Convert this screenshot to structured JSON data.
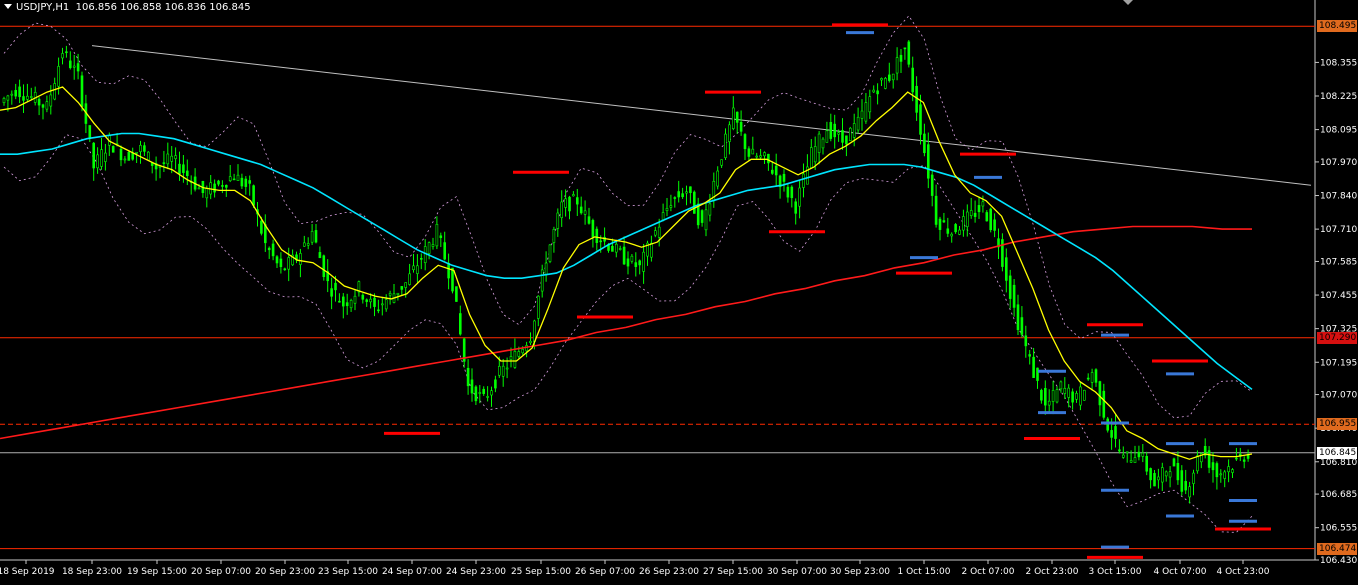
{
  "header": {
    "symbol": "USDJPY,H1",
    "ohlc": "106.856 106.858 106.836 106.845"
  },
  "colors": {
    "background": "#000000",
    "candle": "#00ff00",
    "ma_fast": "#ffff00",
    "ma_mid": "#00e5ff",
    "ma_slow": "#ff1a1a",
    "bands": "#d8a0e0",
    "trendline": "#c0c0c0",
    "resistance": "#ff0000",
    "support": "#3a78d8",
    "hline": "#ff2a00"
  },
  "chart_data": {
    "type": "candlestick",
    "title": "USDJPY,H1",
    "y_axis_ticks": [
      "108.355",
      "108.225",
      "108.095",
      "107.970",
      "107.840",
      "107.710",
      "107.585",
      "107.455",
      "107.325",
      "107.195",
      "107.070",
      "106.940",
      "106.810",
      "106.685",
      "106.555",
      "106.430"
    ],
    "ylim": [
      106.43,
      108.55
    ],
    "x_axis_ticks": [
      "18 Sep 2019",
      "18 Sep 23:00",
      "19 Sep 15:00",
      "20 Sep 07:00",
      "20 Sep 23:00",
      "23 Sep 15:00",
      "24 Sep 07:00",
      "24 Sep 23:00",
      "25 Sep 15:00",
      "26 Sep 07:00",
      "26 Sep 23:00",
      "27 Sep 15:00",
      "30 Sep 07:00",
      "30 Sep 23:00",
      "1 Oct 15:00",
      "2 Oct 07:00",
      "2 Oct 23:00",
      "3 Oct 15:00",
      "4 Oct 07:00",
      "4 Oct 23:00"
    ],
    "price_labels": [
      {
        "text": "108.495",
        "value": 108.495,
        "style": "orange"
      },
      {
        "text": "107.290",
        "value": 107.29,
        "style": "red"
      },
      {
        "text": "106.955",
        "value": 106.955,
        "style": "orange"
      },
      {
        "text": "106.845",
        "value": 106.845,
        "style": "current"
      },
      {
        "text": "106.474",
        "value": 106.474,
        "style": "orange"
      }
    ],
    "horizontal_lines": [
      108.495,
      107.29,
      106.955,
      106.474
    ],
    "bid_line": 106.845,
    "trendline": {
      "start": [
        "18 Sep 23:00",
        108.42
      ],
      "end": [
        "4 Oct 23:00",
        107.91
      ]
    },
    "resistance_levels": [
      {
        "time": "30 Sep 23:00",
        "value": 108.5
      },
      {
        "time": "27 Sep 15:00",
        "value": 108.24
      },
      {
        "time": "25 Sep 15:00",
        "value": 107.93
      },
      {
        "time": "2 Oct 07:00",
        "value": 108.0
      },
      {
        "time": "30 Sep 07:00",
        "value": 107.7
      },
      {
        "time": "26 Sep 07:00",
        "value": 107.37
      },
      {
        "time": "1 Oct 15:00",
        "value": 107.54
      },
      {
        "time": "3 Oct 15:00",
        "value": 107.34
      },
      {
        "time": "4 Oct 07:00",
        "value": 107.2
      },
      {
        "time": "24 Sep 07:00",
        "value": 106.92
      },
      {
        "time": "2 Oct 23:00",
        "value": 106.9
      },
      {
        "time": "4 Oct 23:00",
        "value": 106.55
      },
      {
        "time": "3 Oct 15:00",
        "value": 106.44
      }
    ],
    "support_levels": [
      {
        "time": "30 Sep 23:00",
        "value": 108.47
      },
      {
        "time": "2 Oct 07:00",
        "value": 107.91
      },
      {
        "time": "1 Oct 15:00",
        "value": 107.6
      },
      {
        "time": "3 Oct 15:00",
        "value": 107.3
      },
      {
        "time": "2 Oct 23:00",
        "value": 107.16
      },
      {
        "time": "2 Oct 23:00",
        "value": 107.0
      },
      {
        "time": "3 Oct 15:00",
        "value": 106.96
      },
      {
        "time": "4 Oct 07:00",
        "value": 107.15
      },
      {
        "time": "4 Oct 07:00",
        "value": 106.88
      },
      {
        "time": "3 Oct 15:00",
        "value": 106.7
      },
      {
        "time": "4 Oct 23:00",
        "value": 106.88
      },
      {
        "time": "4 Oct 23:00",
        "value": 106.66
      },
      {
        "time": "4 Oct 07:00",
        "value": 106.6
      },
      {
        "time": "4 Oct 23:00",
        "value": 106.58
      },
      {
        "time": "3 Oct 15:00",
        "value": 106.48
      }
    ],
    "series": [
      {
        "name": "close",
        "values": [
          108.2,
          108.25,
          108.22,
          108.18,
          108.4,
          108.3,
          107.95,
          108.05,
          107.99,
          108.02,
          107.95,
          107.98,
          107.92,
          107.85,
          107.88,
          107.92,
          107.86,
          107.65,
          107.55,
          107.6,
          107.7,
          107.5,
          107.42,
          107.48,
          107.4,
          107.45,
          107.5,
          107.6,
          107.7,
          107.5,
          107.1,
          107.05,
          107.15,
          107.22,
          107.3,
          107.6,
          107.8,
          107.82,
          107.7,
          107.65,
          107.6,
          107.56,
          107.7,
          107.82,
          107.86,
          107.72,
          107.95,
          108.15,
          108.0,
          107.98,
          107.9,
          107.8,
          108.0,
          108.1,
          108.05,
          108.12,
          108.25,
          108.3,
          108.41,
          108.1,
          107.75,
          107.7,
          107.75,
          107.8,
          107.66,
          107.4,
          107.2,
          107.02,
          107.1,
          107.05,
          107.16,
          106.95,
          106.82,
          106.85,
          106.72,
          106.8,
          106.7,
          106.86,
          106.76,
          106.8,
          106.845
        ]
      },
      {
        "name": "MA fast",
        "values": [
          108.17,
          108.18,
          108.21,
          108.24,
          108.26,
          108.2,
          108.12,
          108.05,
          108.02,
          107.99,
          107.96,
          107.94,
          107.9,
          107.87,
          107.86,
          107.86,
          107.82,
          107.72,
          107.63,
          107.59,
          107.58,
          107.54,
          107.49,
          107.47,
          107.45,
          107.44,
          107.46,
          107.52,
          107.57,
          107.55,
          107.38,
          107.26,
          107.2,
          107.2,
          107.25,
          107.4,
          107.56,
          107.65,
          107.68,
          107.67,
          107.66,
          107.64,
          107.66,
          107.72,
          107.78,
          107.81,
          107.85,
          107.94,
          107.98,
          107.98,
          107.95,
          107.92,
          107.95,
          108.0,
          108.03,
          108.07,
          108.13,
          108.18,
          108.24,
          108.2,
          108.05,
          107.92,
          107.85,
          107.82,
          107.76,
          107.62,
          107.48,
          107.32,
          107.2,
          107.12,
          107.08,
          107.02,
          106.93,
          106.9,
          106.86,
          106.84,
          106.82,
          106.84,
          106.83,
          106.83,
          106.84
        ]
      },
      {
        "name": "MA mid",
        "values": [
          108.0,
          108.0,
          108.01,
          108.02,
          108.04,
          108.06,
          108.07,
          108.08,
          108.08,
          108.07,
          108.06,
          108.04,
          108.02,
          108.0,
          107.98,
          107.96,
          107.93,
          107.9,
          107.87,
          107.83,
          107.79,
          107.75,
          107.71,
          107.67,
          107.63,
          107.6,
          107.57,
          107.55,
          107.53,
          107.52,
          107.52,
          107.53,
          107.54,
          107.57,
          107.61,
          107.65,
          107.68,
          107.71,
          107.74,
          107.77,
          107.8,
          107.82,
          107.84,
          107.86,
          107.87,
          107.88,
          107.9,
          107.92,
          107.94,
          107.95,
          107.96,
          107.96,
          107.96,
          107.95,
          107.93,
          107.91,
          107.88,
          107.84,
          107.8,
          107.76,
          107.72,
          107.68,
          107.64,
          107.6,
          107.55,
          107.49,
          107.43,
          107.37,
          107.31,
          107.25,
          107.19,
          107.14,
          107.09
        ]
      },
      {
        "name": "MA slow",
        "values": [
          106.9,
          106.92,
          106.94,
          106.96,
          106.98,
          107.0,
          107.02,
          107.04,
          107.06,
          107.08,
          107.1,
          107.12,
          107.14,
          107.16,
          107.18,
          107.2,
          107.22,
          107.24,
          107.26,
          107.28,
          107.31,
          107.33,
          107.36,
          107.38,
          107.41,
          107.43,
          107.46,
          107.48,
          107.51,
          107.53,
          107.56,
          107.58,
          107.61,
          107.63,
          107.66,
          107.68,
          107.7,
          107.71,
          107.72,
          107.72,
          107.72,
          107.71,
          107.71
        ]
      }
    ]
  }
}
